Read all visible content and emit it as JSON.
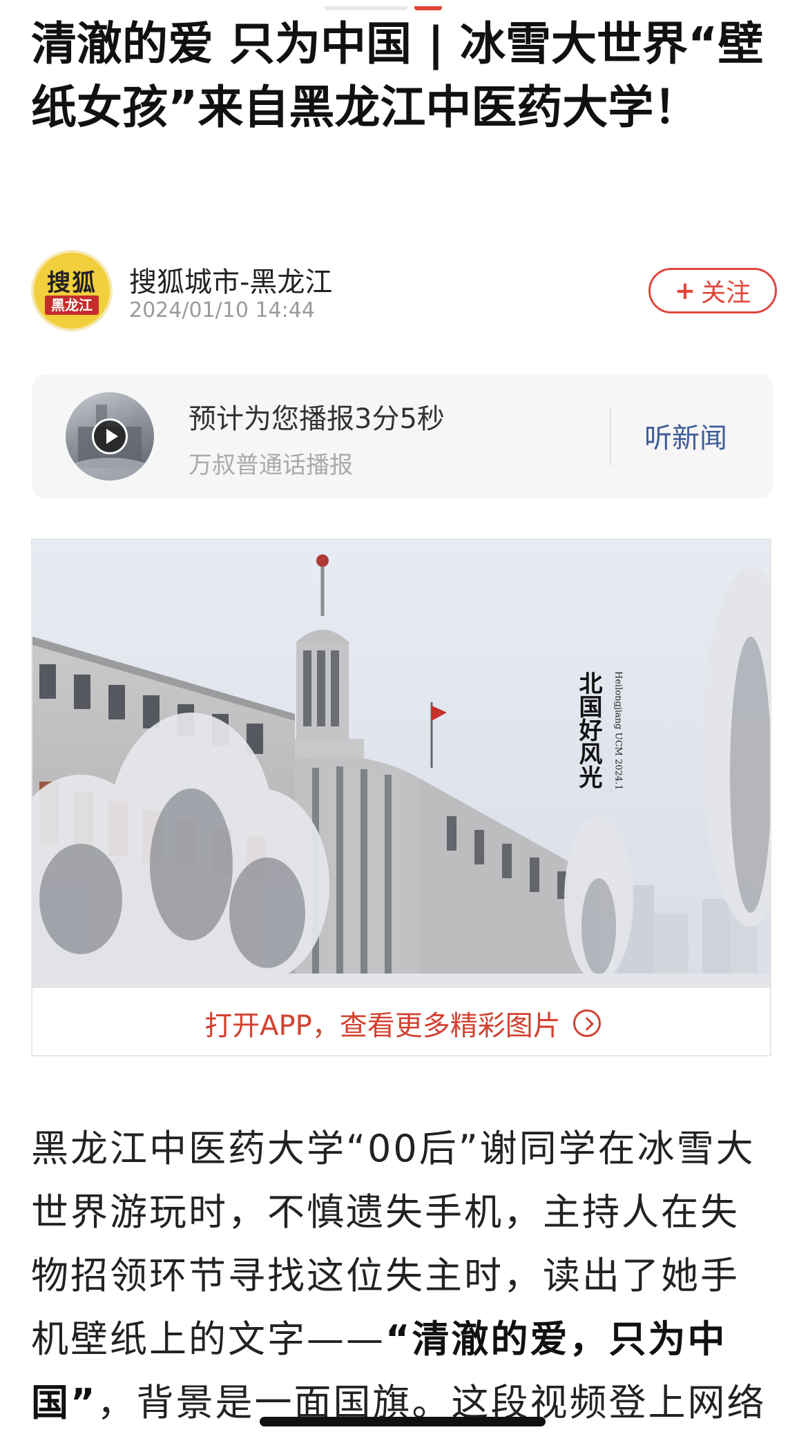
{
  "article": {
    "title": "清澈的爱 只为中国 | 冰雪大世界“壁纸女孩”来自黑龙江中医药大学！"
  },
  "author": {
    "avatar_logo_text": "搜狐",
    "avatar_badge_text": "黑龙江",
    "name": "搜狐城市-黑龙江",
    "date": "2024/01/10 14:44",
    "follow_icon": "+",
    "follow_label": "关注"
  },
  "audio": {
    "title": "预计为您播报3分5秒",
    "subtitle": "万叔普通话播报",
    "listen_label": "听新闻"
  },
  "photo": {
    "overlay_text": "北国好风光",
    "overlay_small": "Heilongjiang UCM 2024.1",
    "caption": "打开APP，查看更多精彩图片"
  },
  "body": {
    "p1_part1": "黑龙江中医药大学“00后”谢同学在冰雪大世界游玩时，不慎遗失手机，主持人在失物招领环节寻找这位失主时，读出了她手机壁纸上的文字——",
    "p1_bold": "“清澈的爱，只为中国”",
    "p1_part2": "，背景是一面国旗。这段视频登上网络"
  },
  "colors": {
    "accent_red": "#e0463c",
    "link_blue": "#3f5d98",
    "caption_red": "#d2412f"
  }
}
